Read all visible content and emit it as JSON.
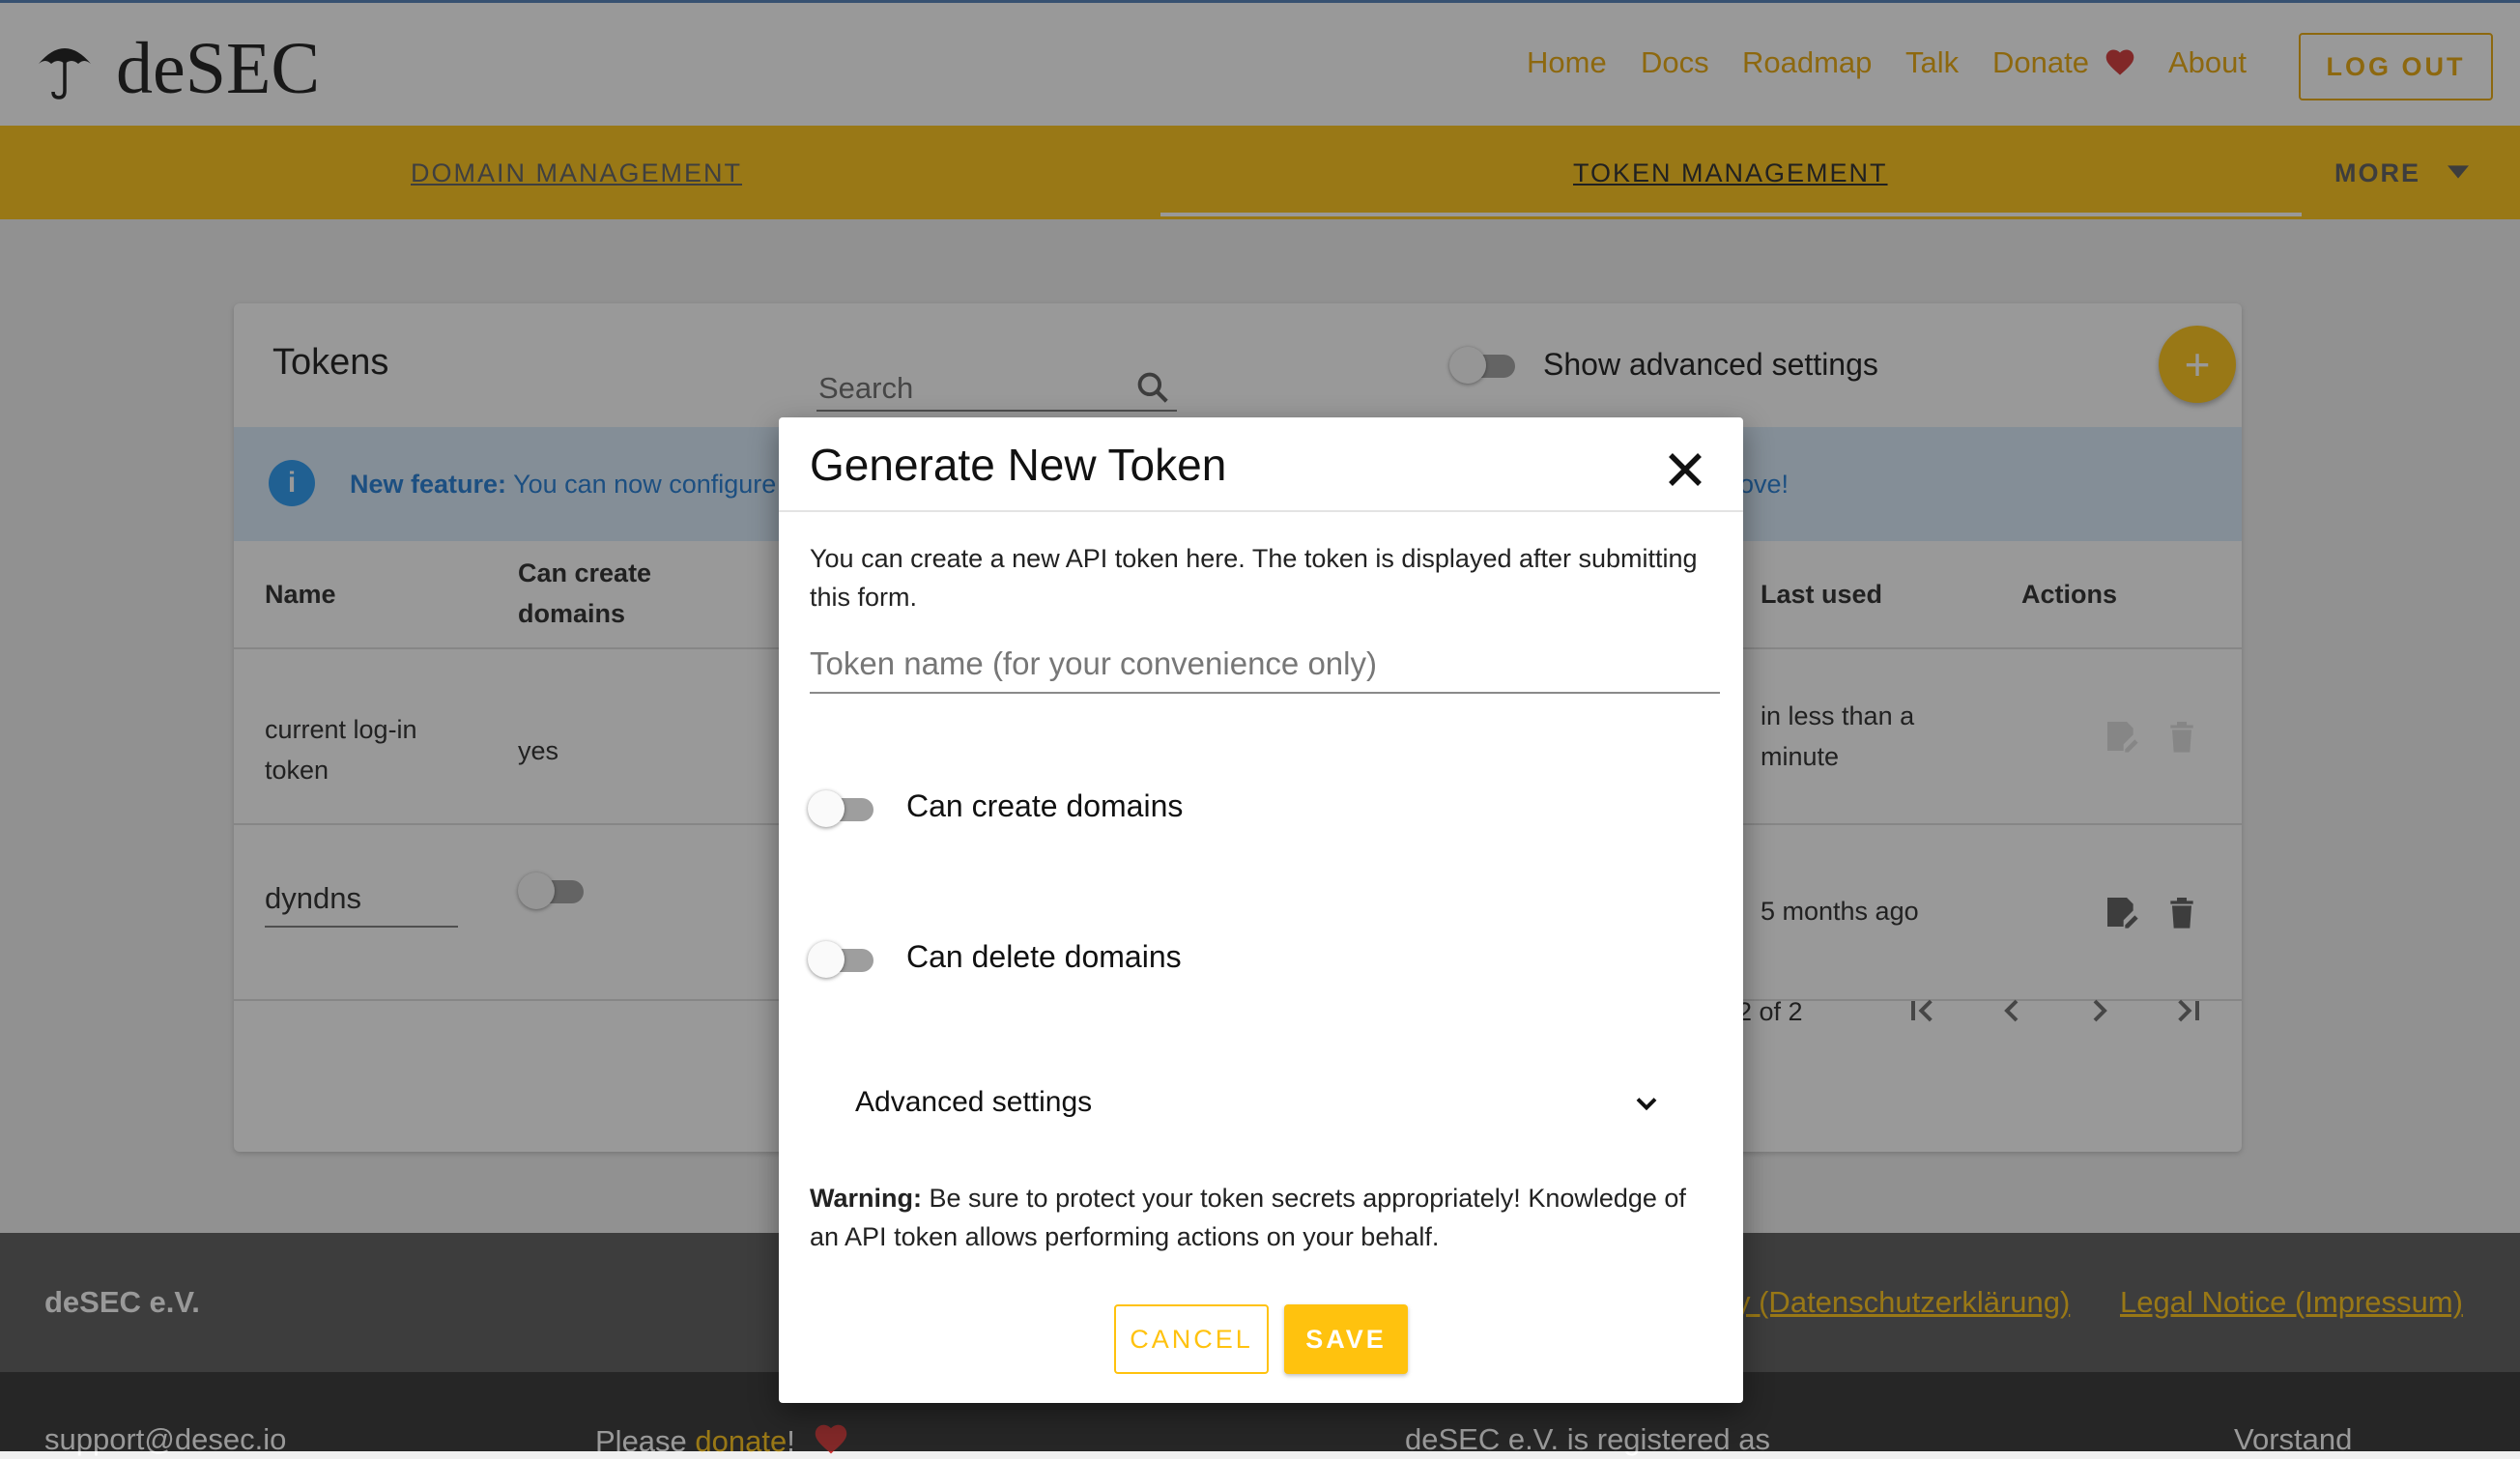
{
  "brand": {
    "name": "deSEC"
  },
  "nav": {
    "home": "Home",
    "docs": "Docs",
    "roadmap": "Roadmap",
    "talk": "Talk",
    "donate": "Donate",
    "about": "About",
    "logout": "LOG OUT"
  },
  "tabs": {
    "domain": "DOMAIN MANAGEMENT",
    "token": "TOKEN MANAGEMENT",
    "more": "MORE"
  },
  "tokens_card": {
    "title": "Tokens",
    "search_placeholder": "Search",
    "advanced_toggle_label": "Show advanced settings",
    "info_bold": "New feature:",
    "info_text": "You can now configure",
    "info_end": "ove!",
    "columns": {
      "name": "Name",
      "can_create_1": "Can create",
      "can_create_2": "domains",
      "last_used": "Last used",
      "actions": "Actions"
    },
    "rows": [
      {
        "name_1": "current log-in",
        "name_2": "token",
        "can_create": "yes",
        "last_used_1": "in less than a",
        "last_used_2": "minute"
      },
      {
        "name": "dyndns",
        "last_used": "5 months ago"
      }
    ],
    "pagination": "2 of 2"
  },
  "footer": {
    "brand": "deSEC e.V.",
    "privacy": "y (Datenschutzerklärung)",
    "legal": "Legal Notice (Impressum)",
    "support": "support@desec.io",
    "please": "Please",
    "donate_link": "donate",
    "exclaim": "!",
    "registered": "deSEC e.V. is registered as",
    "vorstand": "Vorstand"
  },
  "dialog": {
    "title": "Generate New Token",
    "intro": "You can create a new API token here. The token is displayed after submitting this form.",
    "token_name_placeholder": "Token name (for your convenience only)",
    "can_create_label": "Can create domains",
    "can_delete_label": "Can delete domains",
    "advanced_label": "Advanced settings",
    "warning_bold": "Warning:",
    "warning_text": "Be sure to protect your token secrets appropriately! Knowledge of an API token allows performing actions on your behalf.",
    "cancel": "CANCEL",
    "save": "SAVE"
  },
  "colors": {
    "accent": "#ffc20e",
    "info": "#1976d2",
    "heart": "#d32f2f"
  },
  "icons": [
    "umbrella-logo-icon",
    "heart-icon",
    "caret-down-icon",
    "search-icon",
    "plus-icon",
    "info-icon",
    "edit-icon",
    "delete-icon",
    "first-page-icon",
    "prev-page-icon",
    "next-page-icon",
    "last-page-icon",
    "close-icon",
    "chevron-down-icon"
  ]
}
